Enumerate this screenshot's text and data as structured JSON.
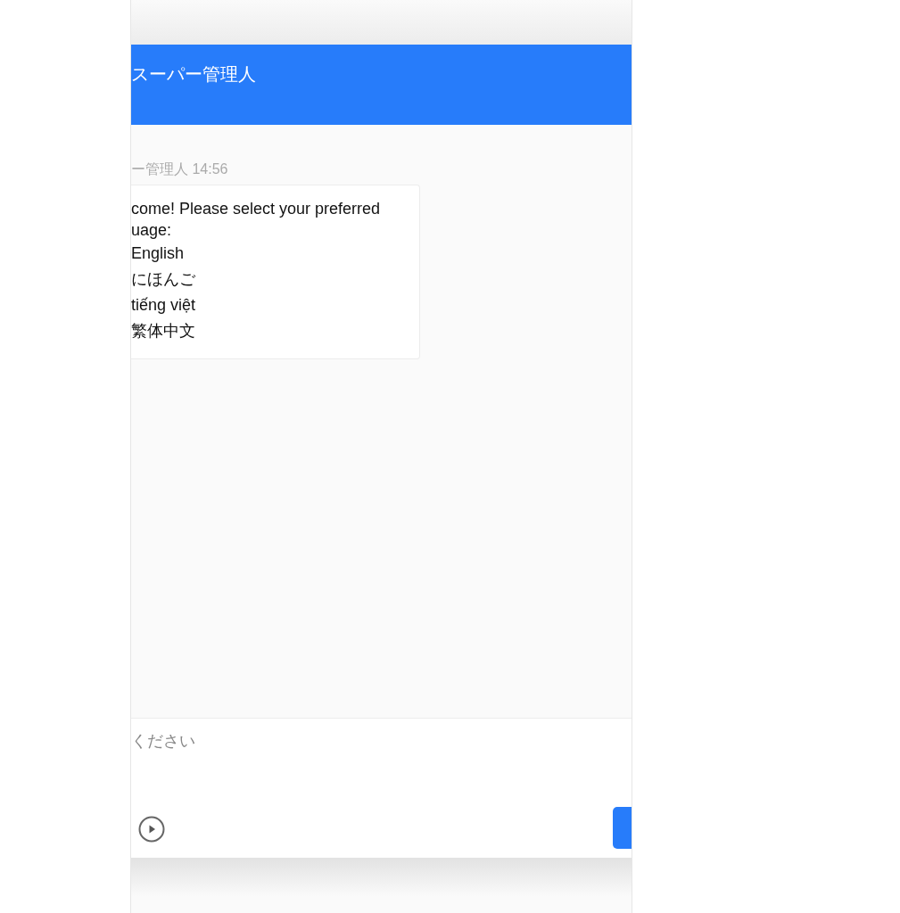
{
  "header": {
    "title": "スーパー管理人"
  },
  "messages": [
    {
      "sender_time": "ー管理人 14:56",
      "intro": [
        "come! Please select your preferred",
        "uage:"
      ],
      "options": [
        "English",
        "にほんご",
        "tiếng việt",
        "繁体中文"
      ]
    }
  ],
  "composer": {
    "placeholder": "ください"
  }
}
